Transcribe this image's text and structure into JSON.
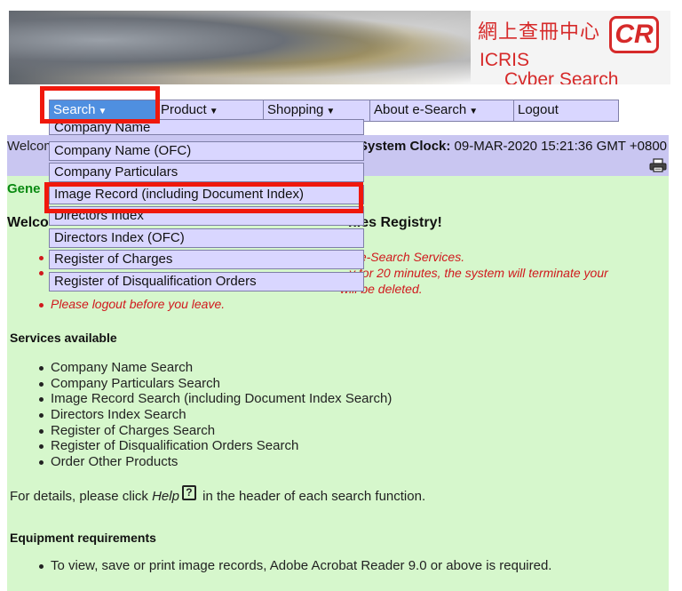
{
  "banner": {
    "chinese_title": "網上查冊中心",
    "logo_text": "CR",
    "icris": "ICRIS",
    "subtitle": "Cyber Search Centre"
  },
  "nav": {
    "items": [
      {
        "label": "Search",
        "caret": "▼",
        "active": true
      },
      {
        "label": "Product",
        "caret": "▼"
      },
      {
        "label": "Shopping",
        "caret": "▼"
      },
      {
        "label": "About e-Search",
        "caret": "▼"
      },
      {
        "label": "Logout"
      }
    ]
  },
  "dropdown": {
    "items": [
      "Company Name",
      "Company Name (OFC)",
      "Company Particulars",
      "Image Record (including Document Index)",
      "Directors Index",
      "Directors Index (OFC)",
      "Register of Charges",
      "Register of Disqualification Orders"
    ]
  },
  "status": {
    "welcome_short": "Welcom",
    "clock_label": "System Clock:",
    "clock_value": "09-MAR-2020 15:21:36 GMT +0800",
    "print_icon": "printer-icon"
  },
  "main": {
    "section_tab": "Gene",
    "welcome_left": "Welco",
    "welcome_right": "nies Registry!",
    "notices": [
      "ng the e-Search Services.",
      "y for 20 minutes, the system will terminate your",
      "will be deleted.",
      "Please logout before you leave."
    ],
    "services_heading": "Services available",
    "services": [
      "Company Name Search",
      "Company Particulars Search",
      "Image Record Search (including Document Index Search)",
      "Directors Index Search",
      "Register of Charges Search",
      "Register of Disqualification Orders Search",
      "Order Other Products"
    ],
    "help_prefix": "For details, please click ",
    "help_word": "Help",
    "help_icon": "?",
    "help_suffix": " in the header of each search function.",
    "equipment_heading": "Equipment requirements",
    "equipment_item": "To view, save or print image records, Adobe Acrobat Reader 9.0 or above is required."
  },
  "colors": {
    "highlight": "#f0180c",
    "nav_bg": "#d9d6ff",
    "nav_active": "#4f8fe0",
    "status_bg": "#c9c6f1",
    "main_bg": "#d6f7cc",
    "notice": "#d0191d",
    "brand_red": "#d62a2a"
  }
}
